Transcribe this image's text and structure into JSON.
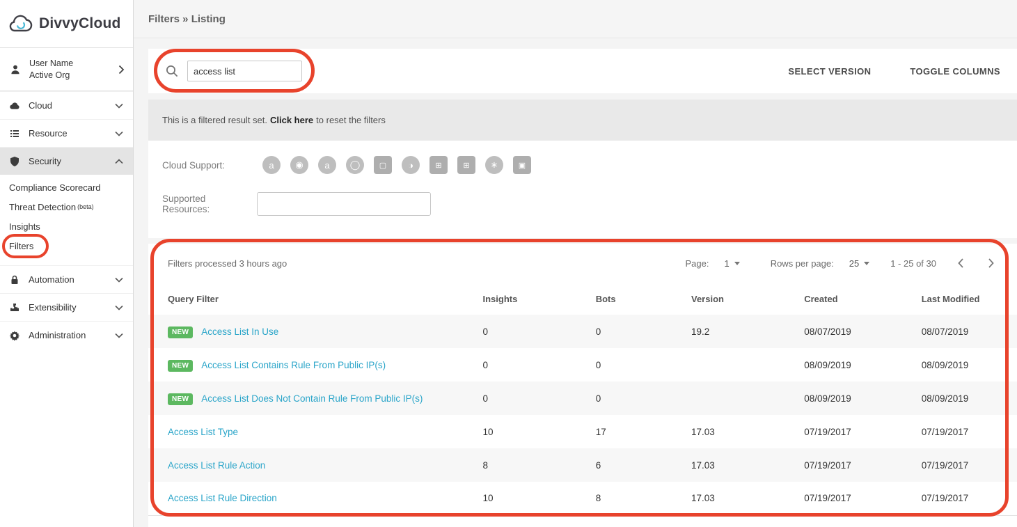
{
  "brand": {
    "name": "DivvyCloud"
  },
  "header": {
    "breadcrumb": "Filters » Listing"
  },
  "sidebar": {
    "user": {
      "name": "User Name",
      "org": "Active Org"
    },
    "items": [
      {
        "label": "Cloud"
      },
      {
        "label": "Resource"
      },
      {
        "label": "Security"
      },
      {
        "label": "Automation"
      },
      {
        "label": "Extensibility"
      },
      {
        "label": "Administration"
      }
    ],
    "security_subitems": [
      {
        "label": "Compliance Scorecard"
      },
      {
        "label": "Threat Detection",
        "suffix": "(beta)"
      },
      {
        "label": "Insights"
      },
      {
        "label": "Filters"
      }
    ]
  },
  "toolbar": {
    "search_value": "access list",
    "select_version": "SELECT VERSION",
    "toggle_columns": "TOGGLE COLUMNS"
  },
  "banner": {
    "text_before": "This is a filtered result set. ",
    "link_text": "Click here",
    "text_after": " to reset the filters"
  },
  "filters_panel": {
    "cloud_support_label": "Cloud Support:",
    "supported_resources_label": "Supported Resources:",
    "supported_resources_value": "",
    "cloud_icons": [
      {
        "name": "aws",
        "glyph": "a"
      },
      {
        "name": "ibm-cloud",
        "glyph": "◉"
      },
      {
        "name": "aws-govcloud",
        "glyph": "a"
      },
      {
        "name": "oracle-cloud",
        "glyph": "◯"
      },
      {
        "name": "alibaba-cloud",
        "glyph": "▢"
      },
      {
        "name": "gcp",
        "glyph": "◑"
      },
      {
        "name": "azure",
        "glyph": "⊞"
      },
      {
        "name": "azure-gov",
        "glyph": "⊞"
      },
      {
        "name": "kubernetes",
        "glyph": "∗"
      },
      {
        "name": "other-cloud",
        "glyph": "▣"
      }
    ]
  },
  "table": {
    "status": "Filters processed 3 hours ago",
    "new_badge": "NEW",
    "pagination": {
      "page_label": "Page:",
      "page_value": "1",
      "rows_label": "Rows per page:",
      "rows_value": "25",
      "range": "1 - 25 of 30"
    },
    "columns": [
      "Query Filter",
      "Insights",
      "Bots",
      "Version",
      "Created",
      "Last Modified"
    ],
    "rows": [
      {
        "name": "Access List In Use",
        "insights": "0",
        "bots": "0",
        "version": "19.2",
        "created": "08/07/2019",
        "modified": "08/07/2019"
      },
      {
        "name": "Access List Contains Rule From Public IP(s)",
        "insights": "0",
        "bots": "0",
        "version": "",
        "created": "08/09/2019",
        "modified": "08/09/2019"
      },
      {
        "name": "Access List Does Not Contain Rule From Public IP(s)",
        "insights": "0",
        "bots": "0",
        "version": "",
        "created": "08/09/2019",
        "modified": "08/09/2019"
      },
      {
        "name": "Access List Type",
        "insights": "10",
        "bots": "17",
        "version": "17.03",
        "created": "07/19/2017",
        "modified": "07/19/2017"
      },
      {
        "name": "Access List Rule Action",
        "insights": "8",
        "bots": "6",
        "version": "17.03",
        "created": "07/19/2017",
        "modified": "07/19/2017"
      },
      {
        "name": "Access List Rule Direction",
        "insights": "10",
        "bots": "8",
        "version": "17.03",
        "created": "07/19/2017",
        "modified": "07/19/2017"
      }
    ]
  },
  "colors": {
    "link": "#2aa5c9",
    "badge_green": "#5cb860",
    "annotation_red": "#e8432c"
  }
}
